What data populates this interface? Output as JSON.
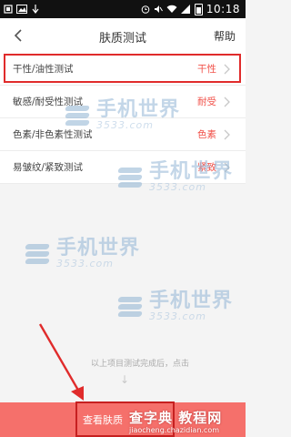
{
  "status_bar": {
    "time": "10:18"
  },
  "header": {
    "title": "肤质测试",
    "help_label": "帮助"
  },
  "tests": [
    {
      "label": "干性/油性测试",
      "result": "干性"
    },
    {
      "label": "敏感/耐受性测试",
      "result": "耐受"
    },
    {
      "label": "色素/非色素性测试",
      "result": "色素"
    },
    {
      "label": "易皱纹/紧致测试",
      "result": "紧致"
    }
  ],
  "hint_text": "以上项目测试完成后，点击",
  "bottom_button": {
    "label": "查看肤质"
  },
  "watermark": {
    "text": "手机世界",
    "sub": "3533.com"
  },
  "site_watermark": {
    "name": "查字典 教程网",
    "url": "jiaocheng.chazidian.com"
  },
  "colors": {
    "accent": "#f1524a",
    "button": "#f5706b",
    "highlight": "#e02b2b"
  }
}
